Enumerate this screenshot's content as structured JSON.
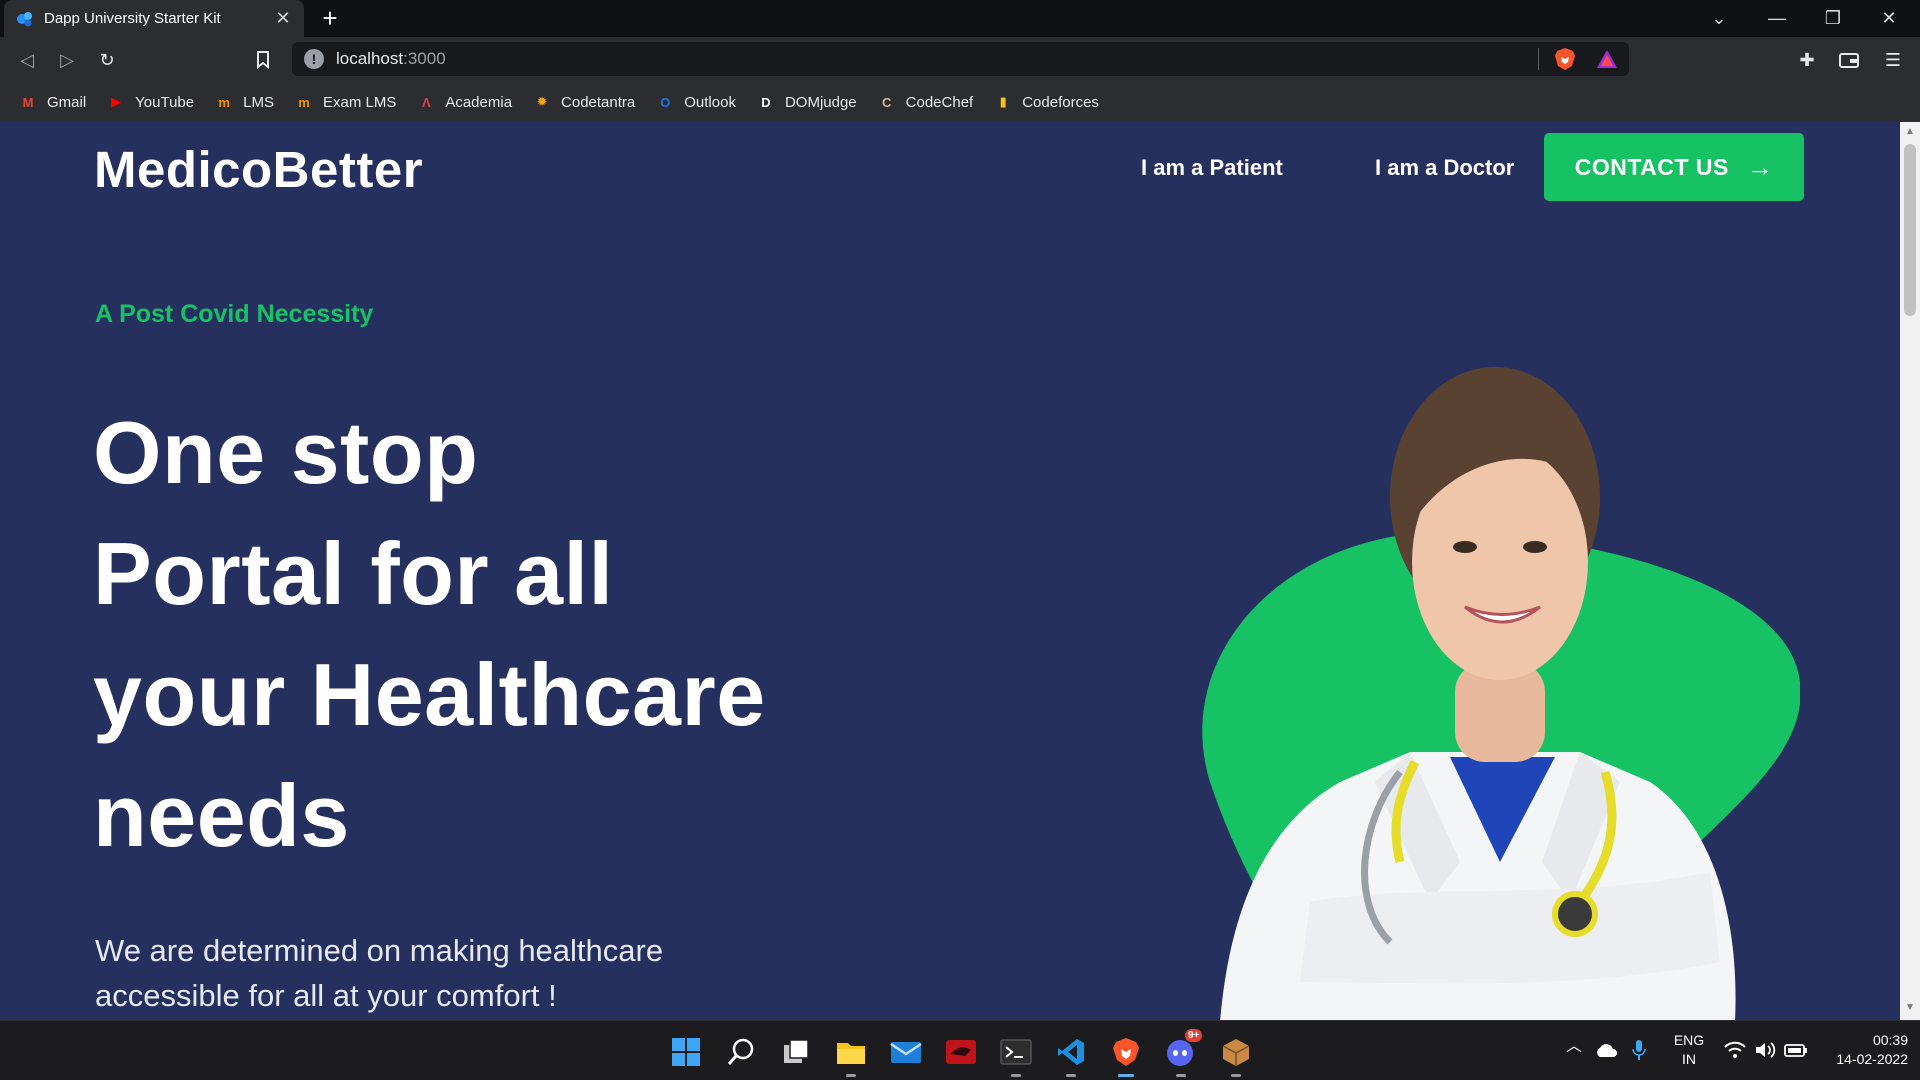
{
  "browser": {
    "tab_title": "Dapp University Starter Kit",
    "new_tab_label": "+",
    "url_host": "localhost",
    "url_port": ":3000"
  },
  "bookmarks": [
    {
      "label": "Gmail",
      "icon": "gmail-icon",
      "color": "#ea4335"
    },
    {
      "label": "YouTube",
      "icon": "youtube-icon",
      "color": "#ff0000"
    },
    {
      "label": "LMS",
      "icon": "lms-icon",
      "color": "#f29100"
    },
    {
      "label": "Exam LMS",
      "icon": "exam-lms-icon",
      "color": "#f29100"
    },
    {
      "label": "Academia",
      "icon": "academia-icon",
      "color": "#e0404a"
    },
    {
      "label": "Codetantra",
      "icon": "codetantra-icon",
      "color": "#f2a30f"
    },
    {
      "label": "Outlook",
      "icon": "outlook-icon",
      "color": "#1a73e8"
    },
    {
      "label": "DOMjudge",
      "icon": "domjudge-icon",
      "color": "#ffffff"
    },
    {
      "label": "CodeChef",
      "icon": "codechef-icon",
      "color": "#c9b99a"
    },
    {
      "label": "Codeforces",
      "icon": "codeforces-icon",
      "color": "#f6c21c"
    }
  ],
  "site": {
    "logo": "MedicoBetter",
    "nav_patient": "I am a Patient",
    "nav_doctor": "I am a Doctor",
    "contact_label": "CONTACT US",
    "contact_arrow": "→",
    "tagline": "A Post Covid Necessity",
    "headline_lines": [
      "One stop",
      "Portal for all",
      "your Healthcare",
      "needs"
    ],
    "subtext_lines": [
      "We are determined on making healthcare",
      "accessible for all at your comfort !"
    ],
    "colors": {
      "background": "#25305e",
      "accent": "#17c264",
      "text": "#ffffff"
    }
  },
  "taskbar": {
    "apps": [
      "windows-start-icon",
      "search-icon",
      "task-view-icon",
      "file-explorer-icon",
      "mail-icon",
      "app-red-icon",
      "terminal-icon",
      "vscode-icon",
      "brave-icon",
      "discord-icon",
      "package-icon"
    ],
    "discord_badge": "9+",
    "language": "ENG",
    "region": "IN",
    "time": "00:39",
    "date": "14-02-2022"
  }
}
